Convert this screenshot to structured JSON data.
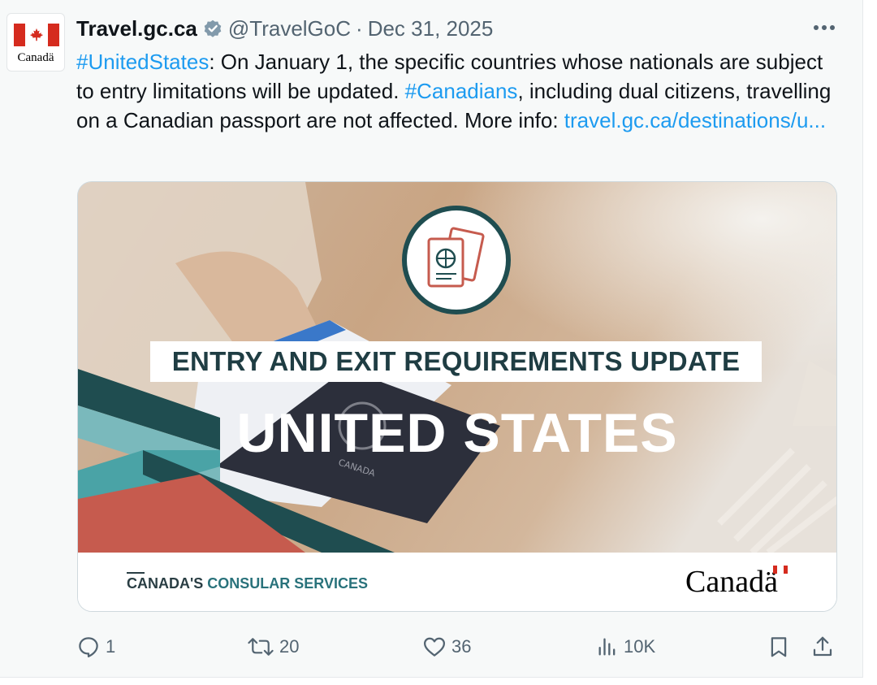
{
  "tweet": {
    "display_name": "Travel.gc.ca",
    "handle": "@TravelGoC",
    "separator": "·",
    "date": "Dec 31, 2025",
    "avatar_wordmark": "Canadä",
    "body": {
      "hashtag1": "#UnitedStates",
      "text1": ": On January 1, the specific countries whose nationals are subject to entry limitations will be updated. ",
      "hashtag2": "#Canadians",
      "text2": ", including dual citizens, travelling on a Canadian passport are not affected. More info: ",
      "link": "travel.gc.ca/destinations/u..."
    },
    "media": {
      "banner_title": "ENTRY AND EXIT REQUIREMENTS UPDATE",
      "banner_country": "UNITED STATES",
      "footer_left_a": "CANADA'S",
      "footer_left_b": "CONSULAR SERVICES",
      "footer_right": "Canadä",
      "passport_text": "CANADA"
    },
    "actions": {
      "replies": "1",
      "reposts": "20",
      "likes": "36",
      "views": "10K"
    }
  },
  "colors": {
    "link": "#1d9bf0",
    "muted": "#536471",
    "canada_red": "#d52b1e",
    "teal_dark": "#1f4d50",
    "teal_light": "#4aa3a6"
  },
  "icons": [
    "verified-badge-icon",
    "more-icon",
    "reply-icon",
    "repost-icon",
    "like-icon",
    "views-icon",
    "bookmark-icon",
    "share-icon",
    "passport-icon"
  ]
}
